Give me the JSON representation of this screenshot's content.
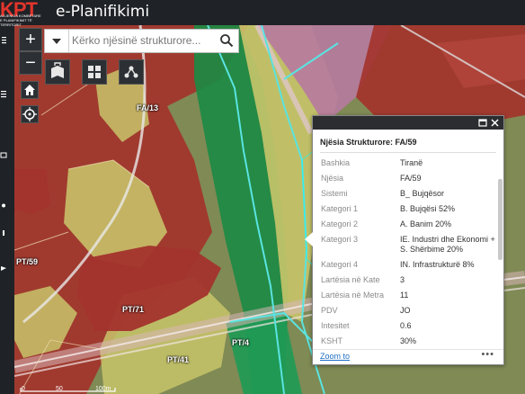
{
  "header": {
    "logo_text": "KPT",
    "logo_subtitle": "AGJENCIA KOMBËTARE E PLANIFIKIMIT TË TERRITORIT",
    "title": "e-Planifikimi"
  },
  "search": {
    "placeholder": "Kërko njësinë strukturore..."
  },
  "zoom": {
    "in_label": "+",
    "out_label": "−"
  },
  "map_labels": [
    "FA/13",
    "PT/59",
    "PT/71",
    "PT/4",
    "PT/41"
  ],
  "scale": {
    "labels": [
      "0",
      "50",
      "100m"
    ]
  },
  "popup": {
    "title": "Njësia Strukturore: FA/59",
    "rows": [
      {
        "key": "Bashkia",
        "value": "Tiranë"
      },
      {
        "key": "Njësia",
        "value": "FA/59"
      },
      {
        "key": "Sistemi",
        "value": "B_ Bujqësor"
      },
      {
        "key": "Kategori 1",
        "value": "B. Bujqësi 52%"
      },
      {
        "key": "Kategori 2",
        "value": "A. Banim 20%"
      },
      {
        "key": "Kategori 3",
        "value": "IE. Industri dhe Ekonomi + S. Shërbime 20%"
      },
      {
        "key": "Kategori 4",
        "value": "IN. Infrastrukturë 8%"
      },
      {
        "key": "Lartësia në Kate",
        "value": "3"
      },
      {
        "key": "Lartësia në Metra",
        "value": "11"
      },
      {
        "key": "PDV",
        "value": "JO"
      },
      {
        "key": "Intesitet",
        "value": "0.6"
      },
      {
        "key": "KSHT",
        "value": "30%"
      }
    ],
    "zoom_to": "Zoom to",
    "more": "•••"
  },
  "colors": {
    "header_bg": "#1f2226",
    "logo_red": "#e1352c",
    "link_blue": "#1f6fc5",
    "parcel_red": "#a3332d",
    "parcel_yellow": "#c8c46a",
    "parcel_green": "#1c8a44",
    "parcel_pink": "#b77a9e",
    "boundary_cyan": "#5ae3e0"
  }
}
